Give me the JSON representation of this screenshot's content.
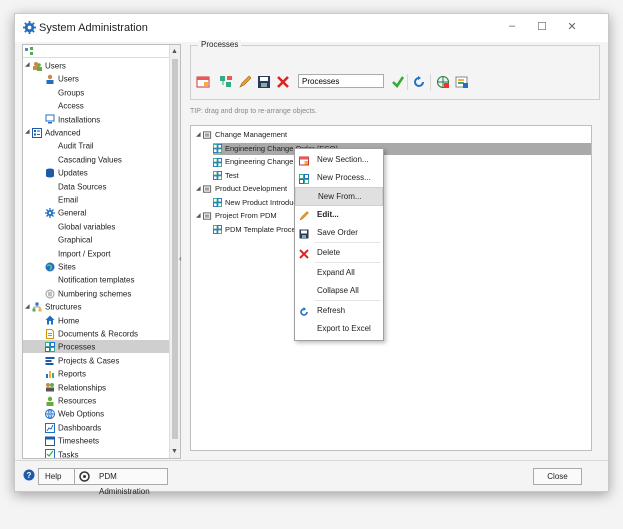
{
  "window": {
    "title": "System Administration"
  },
  "left_tree": [
    {
      "label": "Users",
      "level": 0,
      "expanded": true,
      "icon": "users-icon"
    },
    {
      "label": "Users",
      "level": 1,
      "icon": "user-icon"
    },
    {
      "label": "Groups",
      "level": 2
    },
    {
      "label": "Access",
      "level": 2
    },
    {
      "label": "Installations",
      "level": 1,
      "icon": "monitor-icon"
    },
    {
      "label": "Advanced",
      "level": 0,
      "expanded": true,
      "icon": "advanced-icon"
    },
    {
      "label": "Audit Trail",
      "level": 2
    },
    {
      "label": "Cascading Values",
      "level": 2
    },
    {
      "label": "Updates",
      "level": 1,
      "icon": "database-icon"
    },
    {
      "label": "Data Sources",
      "level": 2
    },
    {
      "label": "Email",
      "level": 2
    },
    {
      "label": "General",
      "level": 1,
      "icon": "gear-icon"
    },
    {
      "label": "Global variables",
      "level": 2
    },
    {
      "label": "Graphical",
      "level": 2
    },
    {
      "label": "Import / Export",
      "level": 2
    },
    {
      "label": "Sites",
      "level": 1,
      "icon": "globe-icon"
    },
    {
      "label": "Notification templates",
      "level": 2
    },
    {
      "label": "Numbering schemes",
      "level": 1,
      "icon": "hash-icon"
    },
    {
      "label": "Structures",
      "level": 0,
      "expanded": true,
      "icon": "structure-icon"
    },
    {
      "label": "Home",
      "level": 1,
      "icon": "home-icon"
    },
    {
      "label": "Documents & Records",
      "level": 1,
      "icon": "document-icon"
    },
    {
      "label": "Processes",
      "level": 1,
      "icon": "process-icon",
      "selected": true
    },
    {
      "label": "Projects & Cases",
      "level": 1,
      "icon": "project-icon"
    },
    {
      "label": "Reports",
      "level": 1,
      "icon": "report-icon"
    },
    {
      "label": "Relationships",
      "level": 1,
      "icon": "relationship-icon"
    },
    {
      "label": "Resources",
      "level": 1,
      "icon": "resource-icon"
    },
    {
      "label": "Web Options",
      "level": 1,
      "icon": "web-icon"
    },
    {
      "label": "Dashboards",
      "level": 1,
      "icon": "dashboard-icon"
    },
    {
      "label": "Timesheets",
      "level": 1,
      "icon": "timesheet-icon"
    },
    {
      "label": "Tasks",
      "level": 1,
      "icon": "task-icon"
    }
  ],
  "processes_panel": {
    "group_label": "Processes",
    "input_value": "Processes",
    "tip": "TIP: drag and drop to re-arrange objects."
  },
  "process_tree": [
    {
      "label": "Change Management",
      "level": 0,
      "expanded": true,
      "type": "folder"
    },
    {
      "label": "Engineering Change Order (ECO)",
      "level": 1,
      "type": "process",
      "selected": true
    },
    {
      "label": "Engineering Change Re",
      "level": 1,
      "type": "process"
    },
    {
      "label": "Test",
      "level": 1,
      "type": "process"
    },
    {
      "label": "Product Development",
      "level": 0,
      "expanded": true,
      "type": "folder"
    },
    {
      "label": "New Product Introduct",
      "level": 1,
      "type": "process"
    },
    {
      "label": "Project From PDM",
      "level": 0,
      "expanded": true,
      "type": "folder"
    },
    {
      "label": "PDM Template Process",
      "level": 1,
      "type": "process"
    }
  ],
  "context_menu": [
    {
      "label": "New Section...",
      "icon": "new-section-icon"
    },
    {
      "label": "New Process...",
      "icon": "new-process-icon"
    },
    {
      "label": "New From...",
      "highlighted": true
    },
    {
      "label": "Edit...",
      "icon": "edit-icon",
      "bold": true
    },
    {
      "label": "Save Order",
      "icon": "save-icon"
    },
    {
      "label": "Delete",
      "icon": "delete-icon",
      "separator_before": true
    },
    {
      "label": "Expand All",
      "separator_before": true
    },
    {
      "label": "Collapse All"
    },
    {
      "label": "Refresh",
      "icon": "refresh-icon",
      "separator_before": true
    },
    {
      "label": "Export to Excel"
    }
  ],
  "bottom": {
    "help_label": "Help",
    "pdm_label": "PDM Administration",
    "close_label": "Close"
  },
  "colors": {
    "selection": "#cfcfcf",
    "selected_process": "#a9a9a9",
    "accent_blue": "#1f6fc5"
  }
}
